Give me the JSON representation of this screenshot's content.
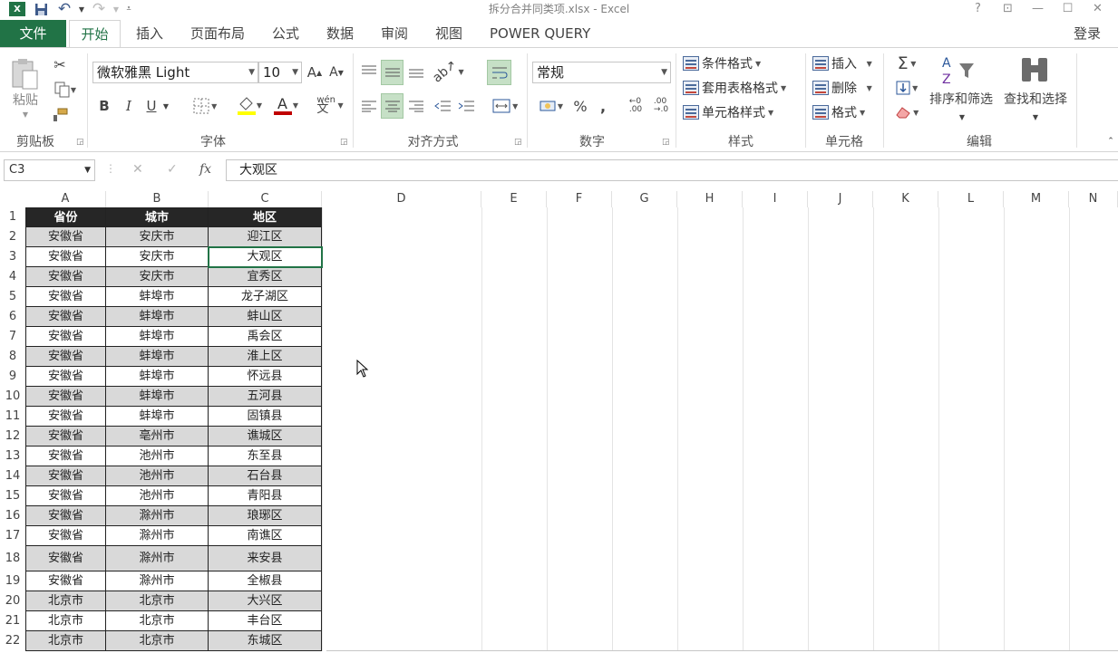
{
  "title_bar": {
    "app_icon": "X",
    "title": "拆分合并同类项.xlsx - Excel",
    "help": "?",
    "window_buttons": [
      "restore-ribbon",
      "minimize",
      "maximize",
      "close"
    ]
  },
  "tabs": [
    "文件",
    "开始",
    "插入",
    "页面布局",
    "公式",
    "数据",
    "审阅",
    "视图",
    "POWER QUERY"
  ],
  "login": "登录",
  "ribbon": {
    "clipboard": {
      "paste": "粘贴",
      "label": "剪贴板"
    },
    "font": {
      "name": "微软雅黑 Light",
      "size": "10",
      "bold": "B",
      "italic": "I",
      "underline": "U",
      "label": "字体",
      "grow": "A",
      "shrink": "A"
    },
    "alignment": {
      "label": "对齐方式"
    },
    "number": {
      "format": "常规",
      "percent": "%",
      "comma": ",",
      "inc_decimal": "←0 .00",
      "dec_decimal": ".00 →.0",
      "label": "数字"
    },
    "styles": {
      "conditional": "条件格式",
      "table": "套用表格格式",
      "cell_styles": "单元格样式",
      "label": "样式"
    },
    "cells": {
      "insert": "插入",
      "delete": "删除",
      "format": "格式",
      "label": "单元格"
    },
    "editing": {
      "sort_filter": "排序和筛选",
      "find_select": "查找和选择",
      "label": "编辑"
    }
  },
  "formula_bar": {
    "name_box": "C3",
    "fx": "fx",
    "value": "大观区"
  },
  "columns": [
    "A",
    "B",
    "C",
    "D",
    "E",
    "F",
    "G",
    "H",
    "I",
    "J",
    "K",
    "L",
    "M",
    "N"
  ],
  "header_row": [
    "省份",
    "城市",
    "地区"
  ],
  "rows": [
    [
      "安徽省",
      "安庆市",
      "迎江区"
    ],
    [
      "安徽省",
      "安庆市",
      "大观区"
    ],
    [
      "安徽省",
      "安庆市",
      "宜秀区"
    ],
    [
      "安徽省",
      "蚌埠市",
      "龙子湖区"
    ],
    [
      "安徽省",
      "蚌埠市",
      "蚌山区"
    ],
    [
      "安徽省",
      "蚌埠市",
      "禹会区"
    ],
    [
      "安徽省",
      "蚌埠市",
      "淮上区"
    ],
    [
      "安徽省",
      "蚌埠市",
      "怀远县"
    ],
    [
      "安徽省",
      "蚌埠市",
      "五河县"
    ],
    [
      "安徽省",
      "蚌埠市",
      "固镇县"
    ],
    [
      "安徽省",
      "亳州市",
      "谯城区"
    ],
    [
      "安徽省",
      "池州市",
      "东至县"
    ],
    [
      "安徽省",
      "池州市",
      "石台县"
    ],
    [
      "安徽省",
      "池州市",
      "青阳县"
    ],
    [
      "安徽省",
      "滁州市",
      "琅琊区"
    ],
    [
      "安徽省",
      "滁州市",
      "南谯区"
    ],
    [
      "安徽省",
      "滁州市",
      "来安县"
    ],
    [
      "安徽省",
      "滁州市",
      "全椒县"
    ],
    [
      "北京市",
      "北京市",
      "大兴区"
    ],
    [
      "北京市",
      "北京市",
      "丰台区"
    ],
    [
      "北京市",
      "北京市",
      "东城区"
    ]
  ],
  "colors": {
    "excel_green": "#217346",
    "header_fill": "#262626",
    "shade_fill": "#d9d9d9",
    "selected_button": "#c6e0c6"
  }
}
